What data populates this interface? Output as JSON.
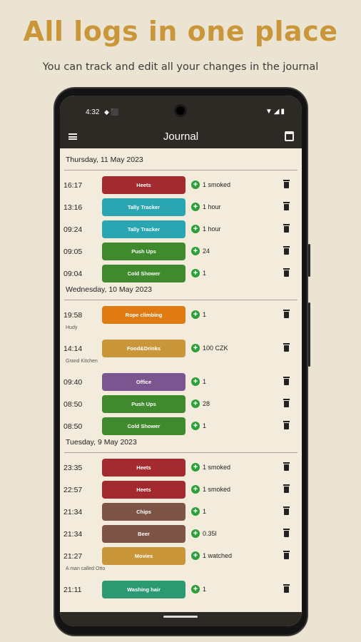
{
  "headline": "All logs in one place",
  "subline": "You can track and edit all your changes in the journal",
  "status": {
    "time": "4:32",
    "left_icons": "◆ ⬛",
    "right_icons": "▼◢▮"
  },
  "appbar": {
    "title": "Journal",
    "menu_icon": "menu-icon",
    "calendar_icon": "calendar-icon"
  },
  "days": [
    {
      "label": "Thursday, 11 May 2023",
      "entries": [
        {
          "time": "16:17",
          "name": "Heets",
          "color": "#a32a2e",
          "value": "1 smoked",
          "note": ""
        },
        {
          "time": "13:16",
          "name": "Tally Tracker",
          "color": "#2aa5b2",
          "value": "1 hour",
          "note": ""
        },
        {
          "time": "09:24",
          "name": "Tally Tracker",
          "color": "#2aa5b2",
          "value": "1 hour",
          "note": ""
        },
        {
          "time": "09:05",
          "name": "Push Ups",
          "color": "#3f8a2c",
          "value": "24",
          "note": ""
        },
        {
          "time": "09:04",
          "name": "Cold Shower",
          "color": "#3f8a2c",
          "value": "1",
          "note": ""
        }
      ]
    },
    {
      "label": "Wednesday, 10 May 2023",
      "entries": [
        {
          "time": "19:58",
          "name": "Rope climbing",
          "color": "#e07a12",
          "value": "1",
          "note": "Hudy"
        },
        {
          "time": "14:14",
          "name": "Food&Drinks",
          "color": "#c9973a",
          "value": "100 CZK",
          "note": "Grand Kitchen"
        },
        {
          "time": "09:40",
          "name": "Office",
          "color": "#7a5590",
          "value": "1",
          "note": ""
        },
        {
          "time": "08:50",
          "name": "Push Ups",
          "color": "#3f8a2c",
          "value": "28",
          "note": ""
        },
        {
          "time": "08:50",
          "name": "Cold Shower",
          "color": "#3f8a2c",
          "value": "1",
          "note": ""
        }
      ]
    },
    {
      "label": "Tuesday, 9 May 2023",
      "entries": [
        {
          "time": "23:35",
          "name": "Heets",
          "color": "#a32a2e",
          "value": "1 smoked",
          "note": ""
        },
        {
          "time": "22:57",
          "name": "Heets",
          "color": "#a32a2e",
          "value": "1 smoked",
          "note": ""
        },
        {
          "time": "21:34",
          "name": "Chips",
          "color": "#7e5447",
          "value": "1",
          "note": ""
        },
        {
          "time": "21:34",
          "name": "Beer",
          "color": "#7e5447",
          "value": "0.35l",
          "note": ""
        },
        {
          "time": "21:27",
          "name": "Movies",
          "color": "#c9973a",
          "value": "1 watched",
          "note": "A man called Otto"
        },
        {
          "time": "21:11",
          "name": "Washing hair",
          "color": "#2b9a72",
          "value": "1",
          "note": ""
        }
      ]
    }
  ]
}
